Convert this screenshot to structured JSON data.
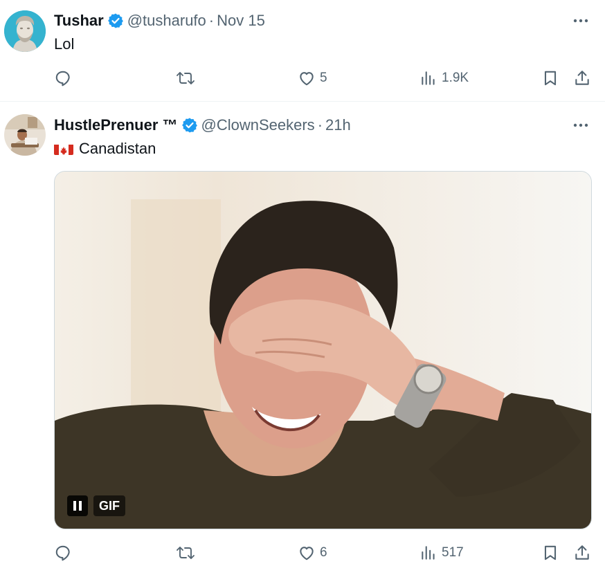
{
  "tweets": [
    {
      "author_name": "Tushar",
      "handle": "@tusharufo",
      "separator": "·",
      "time": "Nov 15",
      "text": "Lol",
      "avatar_icon": "statue-bust-avatar",
      "stats": {
        "reply": "",
        "retweet": "",
        "like": "5",
        "views": "1.9K"
      }
    },
    {
      "author_name": "HustlePrenuer ™",
      "handle": "@ClownSeekers",
      "separator": "·",
      "time": "21h",
      "text": "Canadistan",
      "flag_icon": "canada-flag-emoji",
      "avatar_icon": "person-photo-avatar",
      "media": {
        "type": "gif",
        "badge_label": "GIF",
        "control_icon": "pause-icon"
      },
      "stats": {
        "reply": "",
        "retweet": "",
        "like": "6",
        "views": "517"
      }
    }
  ],
  "colors": {
    "verified": "#1d9bf0",
    "secondary_text": "#536471",
    "primary_text": "#0f1419",
    "divider": "#eff3f4"
  }
}
